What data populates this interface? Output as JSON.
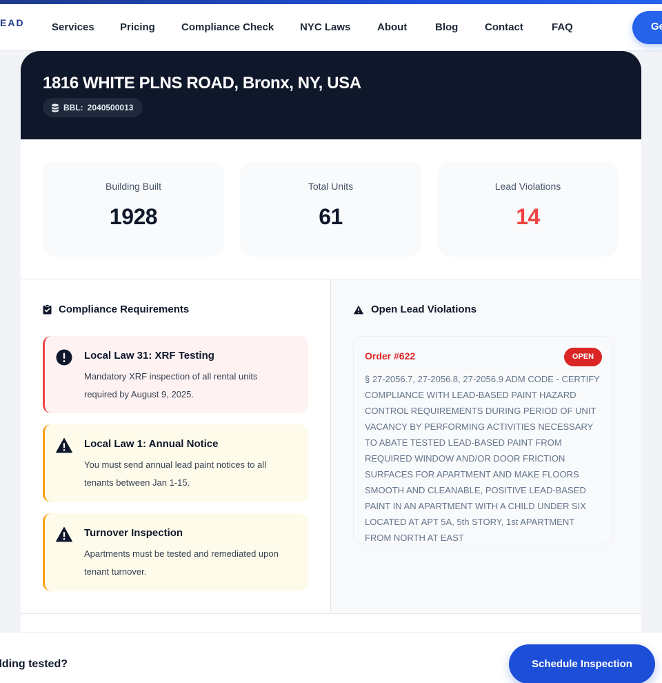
{
  "brand": {
    "logo_text": "EAD"
  },
  "nav": {
    "items": [
      {
        "label": "Services"
      },
      {
        "label": "Pricing"
      },
      {
        "label": "Compliance Check"
      },
      {
        "label": "NYC Laws"
      },
      {
        "label": "About"
      },
      {
        "label": "Blog"
      },
      {
        "label": "Contact"
      },
      {
        "label": "FAQ"
      }
    ],
    "cta_label": "Ge"
  },
  "property": {
    "address": "1816 WHITE PLNS ROAD, Bronx, NY, USA",
    "bbl_label": "BBL:",
    "bbl_value": "2040500013"
  },
  "stats": [
    {
      "label": "Building Built",
      "value": "1928"
    },
    {
      "label": "Total Units",
      "value": "61"
    },
    {
      "label": "Lead Violations",
      "value": "14",
      "color": "#ef4444"
    }
  ],
  "compliance": {
    "title": "Compliance Requirements",
    "items": [
      {
        "title": "Local Law 31: XRF Testing",
        "text": "Mandatory XRF inspection of all rental units required by August 9, 2025.",
        "level": "critical",
        "icon": "alert-circle-icon"
      },
      {
        "title": "Local Law 1: Annual Notice",
        "text": "You must send annual lead paint notices to all tenants between Jan 1-15.",
        "level": "warning",
        "icon": "warning-triangle-icon"
      },
      {
        "title": "Turnover Inspection",
        "text": "Apartments must be tested and remediated upon tenant turnover.",
        "level": "warning",
        "icon": "warning-triangle-icon"
      }
    ]
  },
  "violations": {
    "title": "Open Lead Violations",
    "items": [
      {
        "order": "Order #622",
        "status": "OPEN",
        "description": "§ 27-2056.7, 27-2056.8, 27-2056.9 ADM CODE - CERTIFY COMPLIANCE WITH LEAD-BASED PAINT HAZARD CONTROL REQUIREMENTS DURING PERIOD OF UNIT VACANCY BY PERFORMING ACTIVITIES NECESSARY TO ABATE TESTED LEAD-BASED PAINT FROM REQUIRED WINDOW AND/OR DOOR FRICTION SURFACES FOR APARTMENT AND MAKE FLOORS SMOOTH AND CLEANABLE, POSITIVE LEAD-BASED PAINT IN AN APARTMENT WITH A CHILD UNDER SIX LOCATED AT APT 5A, 5th STORY, 1st APARTMENT FROM NORTH AT EAST"
      }
    ]
  },
  "bottom_bar": {
    "question": "ilding tested?",
    "cta_label": "Schedule Inspection"
  },
  "colors": {
    "accent": "#2563eb",
    "header_bg": "#0f172a",
    "danger": "#ef4444",
    "warning": "#f59e0b"
  }
}
